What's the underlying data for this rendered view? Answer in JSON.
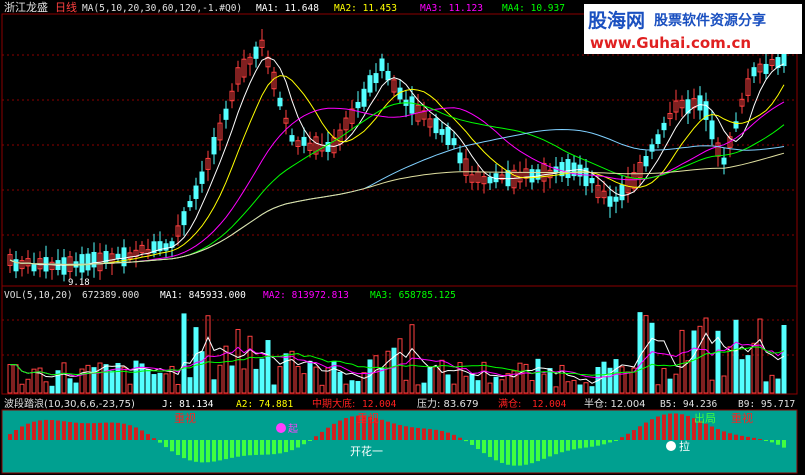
{
  "colors": {
    "background": "#000000",
    "grid": "#8b0000",
    "candle_up": "#ff4040",
    "candle_down": "#54ffff",
    "ma1": "#ffffff",
    "ma2": "#ffff00",
    "ma3": "#ff00ff",
    "ma4": "#00ff00",
    "ma5": "#7fd0ff",
    "ma6": "#e0e0a0",
    "osc_bg": "#00a090",
    "osc_up": "#d02020",
    "osc_down": "#40ff40",
    "label_red": "#ff2020",
    "label_white": "#ffffff"
  },
  "price_panel": {
    "stock_name": "浙江龙盛",
    "period": "日线",
    "ma_params": "MA(5,10,20,30,60,120,-1.#Q0)",
    "ma1": "MA1: 11.648",
    "ma2": "MA2: 11.453",
    "ma3": "MA3: 11.123",
    "ma4": "MA4: 10.937",
    "low_marker": "9.18"
  },
  "volume_panel": {
    "params": "VOL(5,10,20)",
    "vol": "672389.000",
    "ma1": "MA1: 845933.000",
    "ma2": "MA2: 813972.813",
    "ma3": "MA3: 658785.125"
  },
  "osc_panel": {
    "name": "波段踏浪(10,30,6,6,-23,75)",
    "j": "J: 81.134",
    "a2": "A2: 74.881",
    "mid_bottom_label": "中期大底:",
    "mid_bottom_val": "12.004",
    "pressure": "压力: 83.679",
    "full_label": "满仓:",
    "full_val": "12.004",
    "half": "半仓: 12.004",
    "b5": "B5: 94.236",
    "b9": "B9: 95.717",
    "tags": {
      "zhongshi": "重视",
      "kaihua": "开花一",
      "la": "拉",
      "chuju": "出局",
      "qi": "起"
    }
  },
  "watermark": {
    "name": "股海网",
    "subtitle": "股票软件资源分享",
    "url": "www.Guhai.com.cn"
  }
}
